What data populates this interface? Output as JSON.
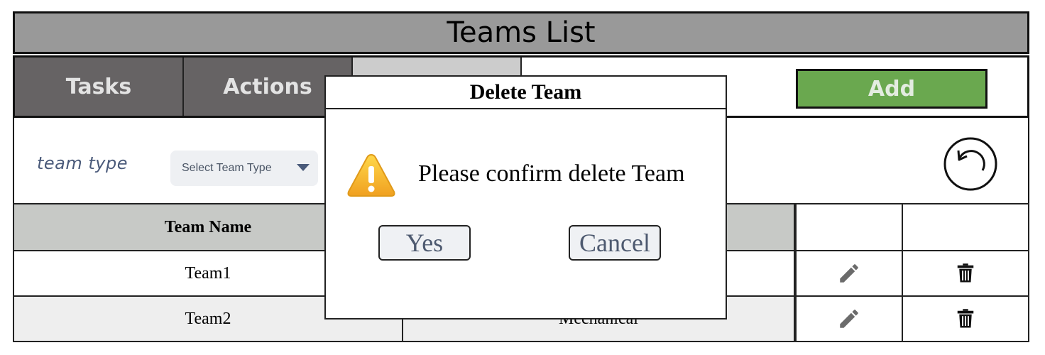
{
  "header": {
    "title": "Teams List"
  },
  "tabs": [
    {
      "label": "Tasks"
    },
    {
      "label": "Actions"
    },
    {
      "label": ""
    }
  ],
  "toolbar": {
    "add_label": "Add",
    "add_color": "#6aa84f"
  },
  "filter": {
    "label": "team type",
    "select_value": "Select Team Type"
  },
  "table": {
    "headers": [
      "Team Name",
      "",
      "",
      ""
    ],
    "rows": [
      {
        "name": "Team1",
        "type": ""
      },
      {
        "name": "Team2",
        "type": "Mechanical"
      }
    ]
  },
  "dialog": {
    "title": "Delete Team",
    "message": "Please confirm delete Team",
    "yes_label": "Yes",
    "cancel_label": "Cancel"
  },
  "icons": [
    "undo-icon",
    "pencil-icon",
    "trash-icon",
    "warning-icon",
    "chevron-down-icon"
  ]
}
